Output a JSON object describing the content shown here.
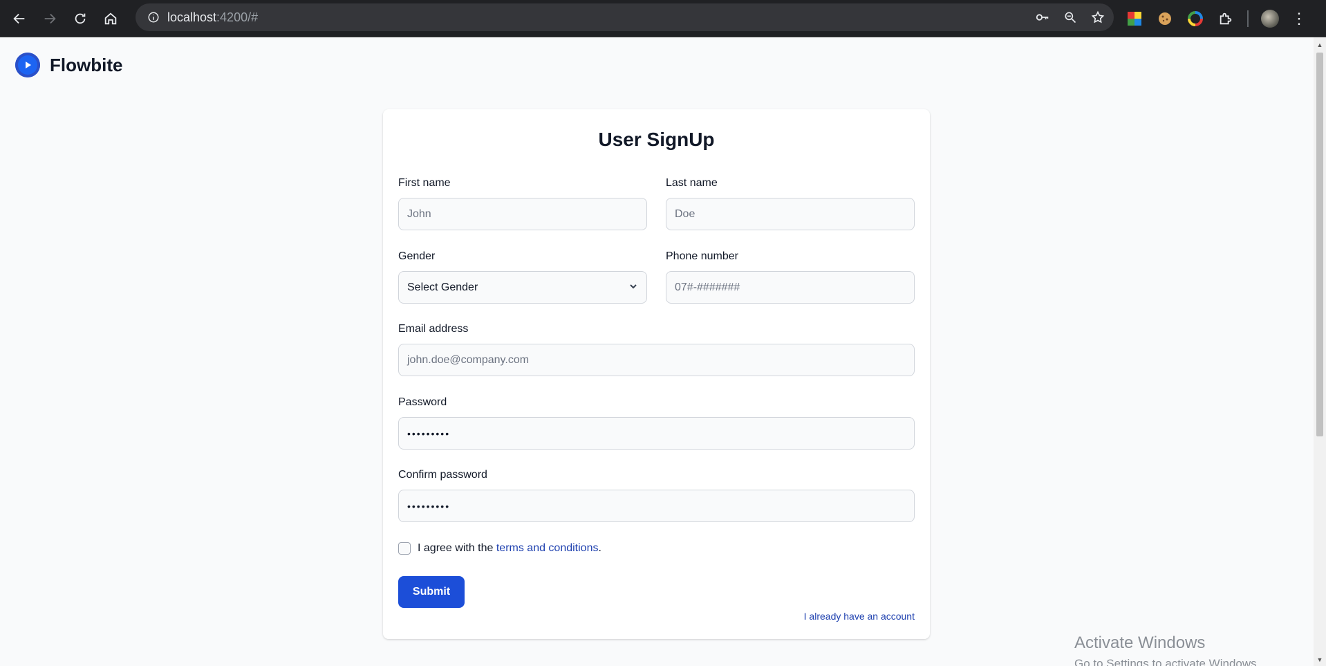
{
  "browser": {
    "url_host": "localhost",
    "url_rest": ":4200/#"
  },
  "brand": {
    "name": "Flowbite"
  },
  "form": {
    "title": "User SignUp",
    "first_name": {
      "label": "First name",
      "placeholder": "John"
    },
    "last_name": {
      "label": "Last name",
      "placeholder": "Doe"
    },
    "gender": {
      "label": "Gender",
      "value": "Select Gender"
    },
    "phone": {
      "label": "Phone number",
      "placeholder": "07#-#######"
    },
    "email": {
      "label": "Email address",
      "placeholder": "john.doe@company.com"
    },
    "password": {
      "label": "Password",
      "value": "•••••••••"
    },
    "confirm_password": {
      "label": "Confirm password",
      "value": "•••••••••"
    },
    "agree_prefix": "I agree with the ",
    "agree_link": "terms and conditions",
    "agree_suffix": ".",
    "submit_label": "Submit",
    "login_link": "I already have an account"
  },
  "watermark": {
    "line1": "Activate Windows",
    "line2": "Go to Settings to activate Windows."
  },
  "colors": {
    "primary": "#1c4ed8",
    "link": "#1e40af",
    "chrome_bg": "#202124"
  }
}
